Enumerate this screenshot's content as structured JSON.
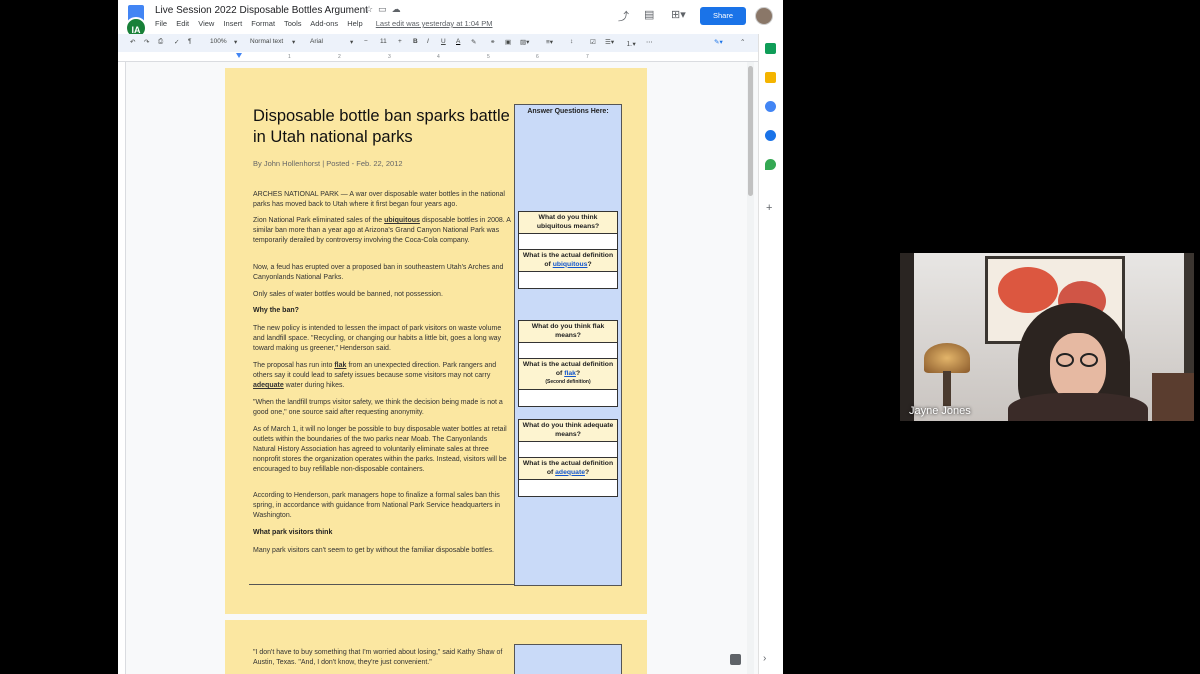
{
  "docs": {
    "title": "Live Session 2022 Disposable Bottles Argument",
    "badge": "IA",
    "menu": [
      "File",
      "Edit",
      "View",
      "Insert",
      "Format",
      "Tools",
      "Add-ons",
      "Help"
    ],
    "last_edit": "Last edit was yesterday at 1:04 PM",
    "share_label": "Share",
    "toolbar": {
      "zoom": "100%",
      "style": "Normal text",
      "font": "Arial",
      "font_size": "11",
      "minus": "−",
      "plus": "+",
      "bold": "B",
      "italic": "I",
      "underline": "U",
      "text_color": "A"
    },
    "ruler_ticks": [
      "1",
      "2",
      "3",
      "4",
      "5",
      "6",
      "7"
    ]
  },
  "article": {
    "title": "Disposable bottle ban sparks battle in Utah national parks",
    "byline": "By John Hollenhorst | Posted - Feb. 22, 2012",
    "p1": "ARCHES NATIONAL PARK — A war over disposable water bottles in the national parks has moved back to Utah where it first began four years ago.",
    "p2_pre": "Zion National Park eliminated sales of the ",
    "p2_word": "ubiquitous",
    "p2_post": " disposable bottles in 2008. A similar ban more than a year ago at Arizona's Grand Canyon National Park was temporarily derailed by controversy involving the Coca-Cola company.",
    "p3": "Now, a feud has erupted over a proposed ban in southeastern Utah's Arches and Canyonlands National Parks.",
    "p4": "Only sales of water bottles would be banned, not possession.",
    "sub1": "Why the ban?",
    "p5": "The new policy is intended to lessen the impact of park visitors on waste volume and landfill space. \"Recycling, or changing our habits a little bit, goes a long way toward making us greener,\" Henderson said.",
    "p6_pre": "The proposal has run into ",
    "p6_word1": "flak",
    "p6_mid": " from an unexpected direction. Park rangers and others say it could lead to safety issues because some visitors may not carry ",
    "p6_word2": "adequate",
    "p6_post": " water during hikes.",
    "p7": "\"When the landfill trumps visitor safety, we think the decision being made is not a good one,\" one source said after requesting anonymity.",
    "p8": "As of March 1, it will no longer be possible to buy disposable water bottles at retail outlets within the boundaries of the two parks near Moab. The Canyonlands Natural History Association has agreed to voluntarily eliminate sales at three nonprofit stores the organization operates within the parks. Instead, visitors will be encouraged to buy refillable non-disposable containers.",
    "p9": "According to Henderson, park managers hope to finalize a formal sales ban this spring, in accordance with guidance from National Park Service headquarters in Washington.",
    "sub2": "What park visitors think",
    "p10": "Many park visitors can't seem to get by without the familiar disposable bottles.",
    "p11": "\"I don't have to buy something that I'm worried about losing,\" said Kathy Shaw of Austin, Texas. \"And, I don't know, they're just convenient.\""
  },
  "questions": {
    "header": "Answer Questions Here:",
    "q1": "What do you think ubiquitous means?",
    "q2_pre": "What is the actual definition of ",
    "q2_word": "ubiquitous",
    "q2_post": "?",
    "q3": "What do you think flak means?",
    "q4_pre": "What is the actual definition of ",
    "q4_word": "flak",
    "q4_post": "?",
    "q4_note": "(Second definition)",
    "q5": "What do you think adequate means?",
    "q6_pre": "What is the actual definition of ",
    "q6_word": "adequate",
    "q6_post": "?"
  },
  "video": {
    "participant_name": "Jayne Jones"
  }
}
